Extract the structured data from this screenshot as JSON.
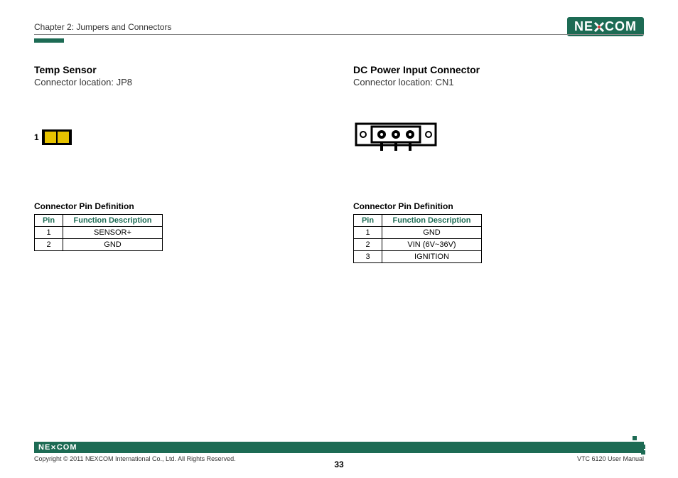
{
  "header": {
    "chapter": "Chapter 2: Jumpers and Connectors",
    "logo_text": "NE COM",
    "logo_x": "X"
  },
  "left": {
    "title": "Temp Sensor",
    "location": "Connector location: JP8",
    "pin_label": "1",
    "table_title": "Connector Pin Definition",
    "th_pin": "Pin",
    "th_func": "Function Description",
    "rows": [
      {
        "pin": "1",
        "func": "SENSOR+"
      },
      {
        "pin": "2",
        "func": "GND"
      }
    ]
  },
  "right": {
    "title": "DC Power Input Connector",
    "location": "Connector location: CN1",
    "table_title": "Connector Pin Definition",
    "th_pin": "Pin",
    "th_func": "Function Description",
    "rows": [
      {
        "pin": "1",
        "func": "GND"
      },
      {
        "pin": "2",
        "func": "VIN (6V~36V)"
      },
      {
        "pin": "3",
        "func": "IGNITION"
      }
    ]
  },
  "footer": {
    "logo": "NEXCOM",
    "copyright": "Copyright © 2011 NEXCOM International Co., Ltd. All Rights Reserved.",
    "page": "33",
    "manual": "VTC 6120 User Manual"
  }
}
